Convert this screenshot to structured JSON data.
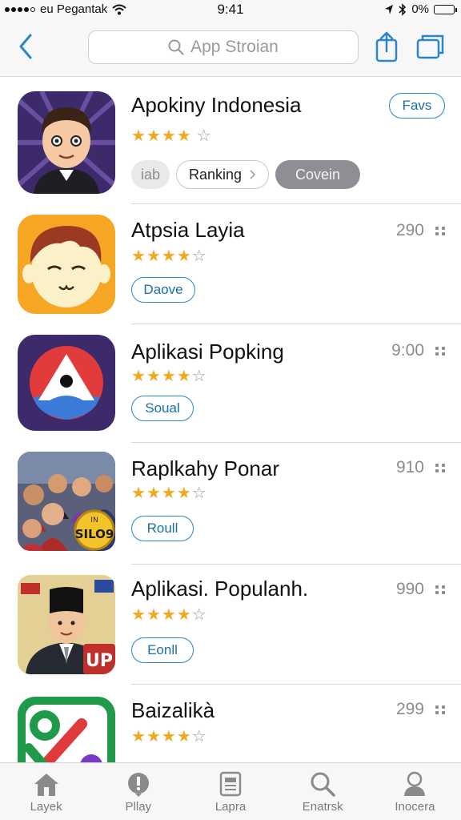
{
  "status_bar": {
    "carrier": "eu Pegantak",
    "time": "9:41",
    "battery": "0%"
  },
  "nav": {
    "search_placeholder": "App Stroian"
  },
  "apps": [
    {
      "name": "Apokiny Indonesia",
      "rating": 3.5,
      "action": "Favs",
      "chips": [
        "iab",
        "Ranking",
        "Covein"
      ],
      "icon": "cartoon-man-icon"
    },
    {
      "name": "Atpsia Layia",
      "rating": 4,
      "meta": "290",
      "action": "Daove",
      "icon": "cartoon-face-icon"
    },
    {
      "name": "Aplikasi Popking",
      "rating": 4,
      "meta": "9:00",
      "action": "Soual",
      "icon": "triangle-logo-icon"
    },
    {
      "name": "Raplkahy Ponar",
      "rating": 4,
      "meta": "910",
      "action": "Roull",
      "icon": "group-photo-icon",
      "icon_badge": "SILO9"
    },
    {
      "name": "Aplikasi. Populanh.",
      "rating": 4,
      "meta": "990",
      "action": "Eonll",
      "icon": "politician-icon",
      "icon_badge": "UP"
    },
    {
      "name": "Baizalikà",
      "rating": 4,
      "meta": "299",
      "icon": "green-logo-icon"
    }
  ],
  "tabbar": [
    {
      "label": "Layek",
      "icon": "home-icon"
    },
    {
      "label": "Pllay",
      "icon": "alert-icon"
    },
    {
      "label": "Lapra",
      "icon": "newspaper-icon"
    },
    {
      "label": "Enatrsk",
      "icon": "search-icon"
    },
    {
      "label": "Inocera",
      "icon": "person-icon"
    }
  ],
  "colors": {
    "accent": "#2a86c7",
    "star": "#f2a81d",
    "separator": "#d8d8d8"
  }
}
